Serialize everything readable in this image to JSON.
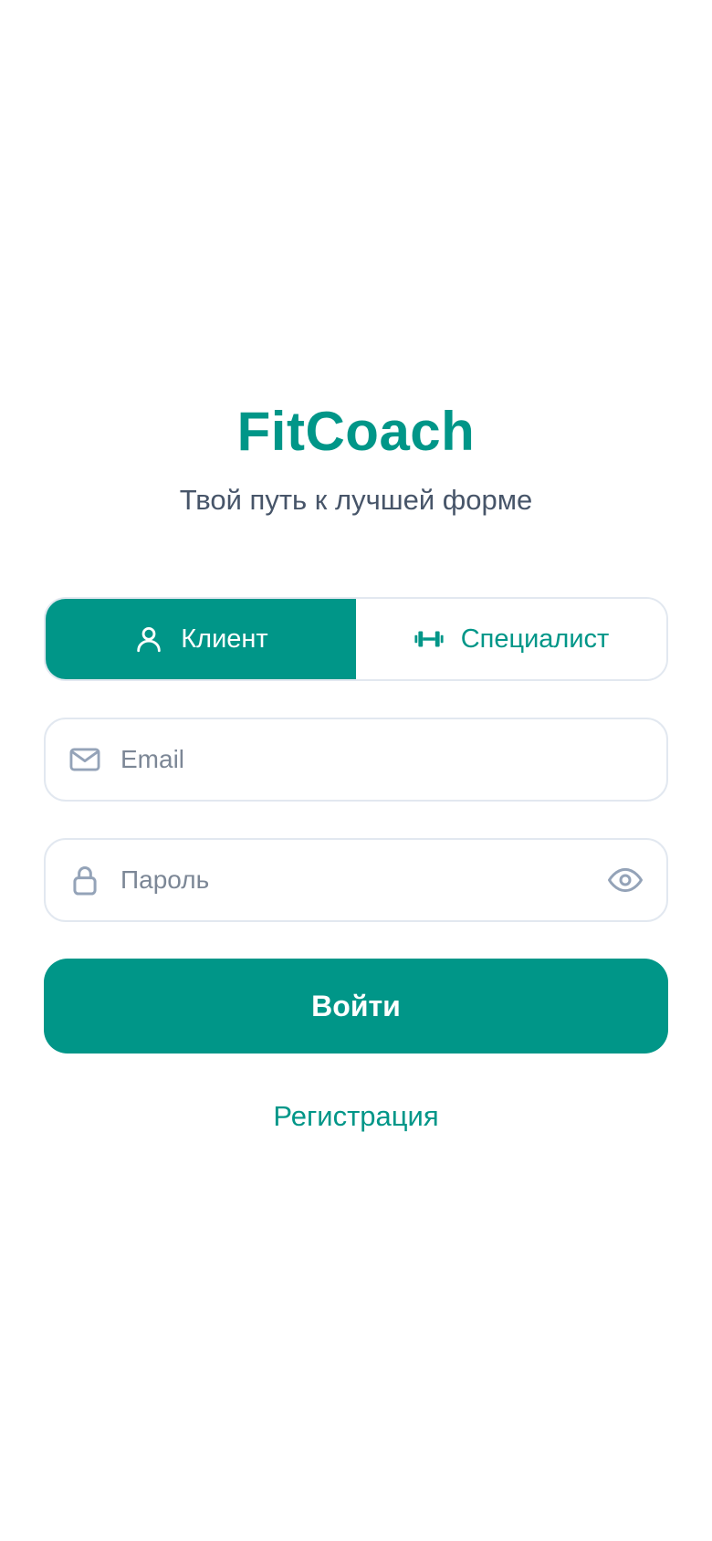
{
  "header": {
    "app_title": "FitCoach",
    "subtitle": "Твой путь к лучшей форме"
  },
  "role_switch": {
    "options": [
      {
        "label": "Клиент",
        "icon": "person-icon",
        "selected": true
      },
      {
        "label": "Специалист",
        "icon": "dumbbell-icon",
        "selected": false
      }
    ]
  },
  "form": {
    "email": {
      "placeholder": "Email",
      "value": "",
      "icon": "mail-icon"
    },
    "password": {
      "placeholder": "Пароль",
      "value": "",
      "icon": "lock-icon",
      "toggle_icon": "eye-icon"
    },
    "submit_label": "Войти",
    "register_label": "Регистрация"
  },
  "colors": {
    "accent": "#009688",
    "subtitle": "#475569",
    "border": "#e2e8f0",
    "placeholder": "#7c8796",
    "icon_gray": "#94a3b8"
  }
}
